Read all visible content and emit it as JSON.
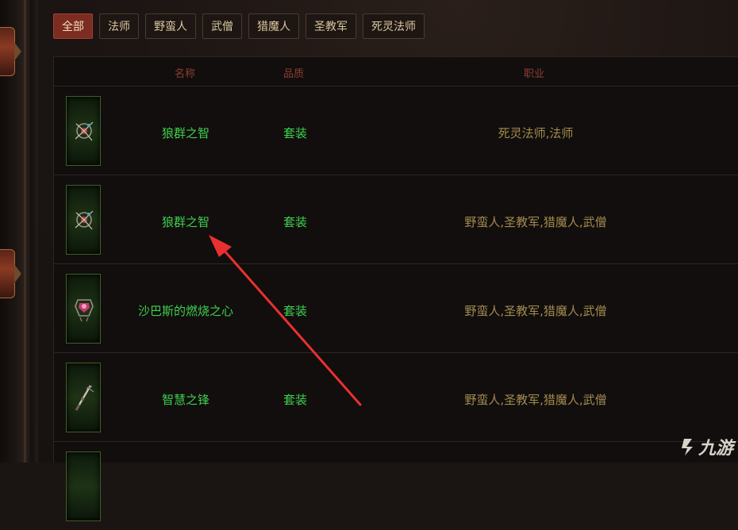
{
  "filters": {
    "tabs": [
      {
        "label": "全部",
        "active": true
      },
      {
        "label": "法师",
        "active": false
      },
      {
        "label": "野蛮人",
        "active": false
      },
      {
        "label": "武僧",
        "active": false
      },
      {
        "label": "猎魔人",
        "active": false
      },
      {
        "label": "圣教军",
        "active": false
      },
      {
        "label": "死灵法师",
        "active": false
      }
    ]
  },
  "table": {
    "headers": {
      "name": "名称",
      "quality": "品质",
      "classes": "职业"
    },
    "rows": [
      {
        "icon": "wolf-amulet-icon",
        "name": "狼群之智",
        "quality": "套装",
        "classes": "死灵法师,法师"
      },
      {
        "icon": "wolf-amulet-icon",
        "name": "狼群之智",
        "quality": "套装",
        "classes": "野蛮人,圣教军,猎魔人,武僧"
      },
      {
        "icon": "crimson-ring-icon",
        "name": "沙巴斯的燃烧之心",
        "quality": "套装",
        "classes": "野蛮人,圣教军,猎魔人,武僧"
      },
      {
        "icon": "dagger-icon",
        "name": "智慧之锋",
        "quality": "套装",
        "classes": "野蛮人,圣教军,猎魔人,武僧"
      }
    ]
  },
  "annotation": {
    "arrow_color": "#e8312f"
  },
  "watermark": {
    "text": "九游"
  },
  "colors": {
    "active_tab": "#7d2c22",
    "set_green": "#3fcf4e",
    "class_gold": "#a38b4e",
    "header_red": "#8e3f33"
  }
}
